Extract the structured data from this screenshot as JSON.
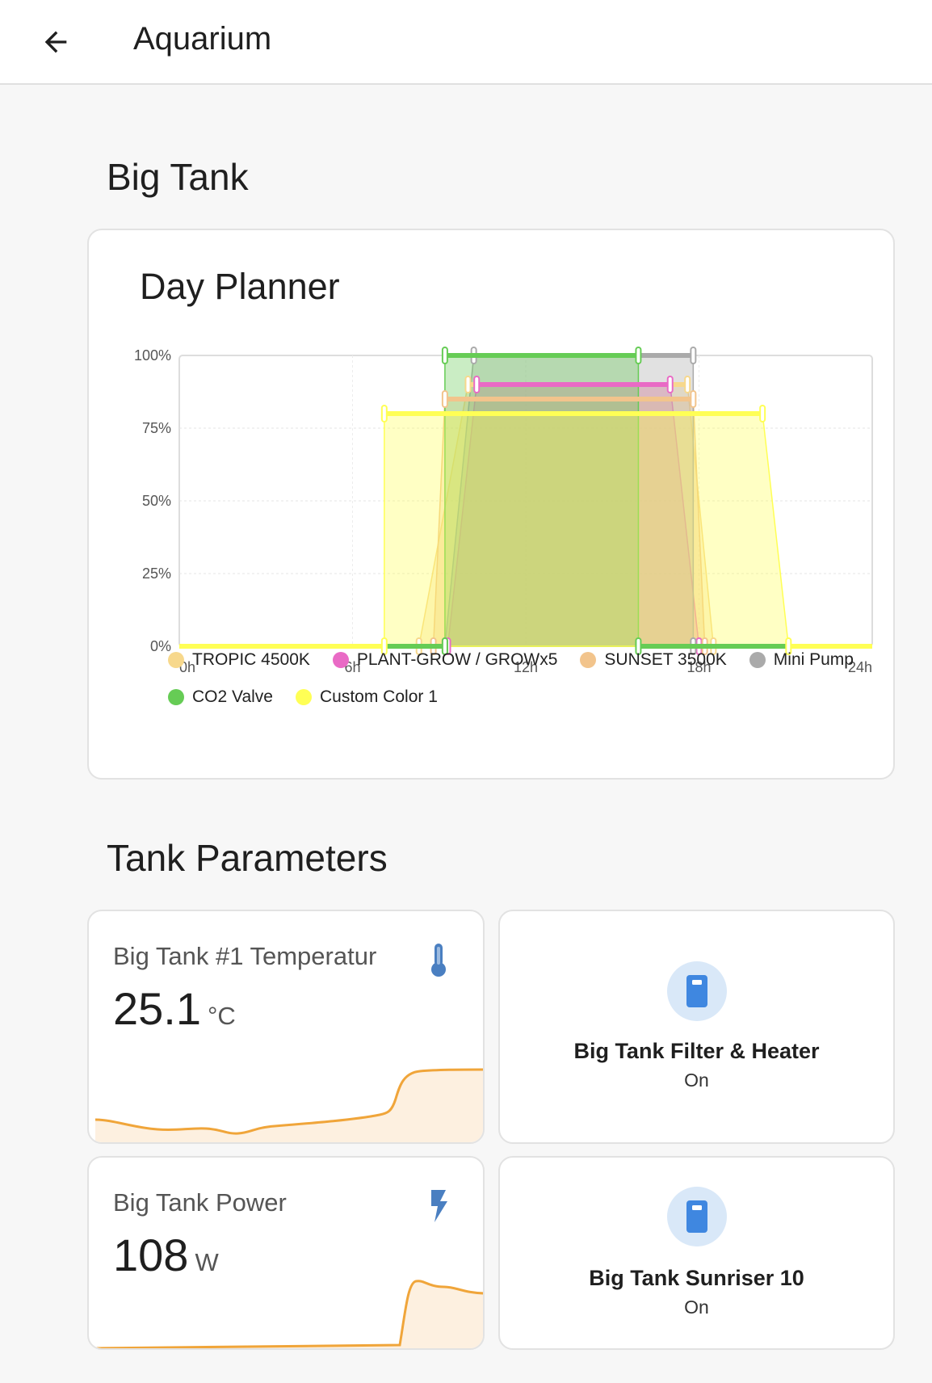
{
  "appbar": {
    "title": "Aquarium"
  },
  "sections": {
    "big_tank": "Big Tank",
    "tank_parameters": "Tank Parameters"
  },
  "planner": {
    "title": "Day Planner",
    "y_ticks": [
      "100%",
      "75%",
      "50%",
      "25%",
      "0%"
    ],
    "x_ticks": [
      "0h",
      "6h",
      "12h",
      "18h",
      "24h"
    ]
  },
  "chart_data": {
    "type": "area",
    "title": "Day Planner",
    "xlim": [
      0,
      24
    ],
    "ylim": [
      0,
      100
    ],
    "x_unit": "h",
    "y_unit": "%",
    "grid": true,
    "legend": "bottom",
    "series": [
      {
        "name": "TROPIC 4500K",
        "color": "#f7d88c",
        "points": [
          [
            0,
            0
          ],
          [
            8.3,
            0
          ],
          [
            10.0,
            90
          ],
          [
            17.6,
            90
          ],
          [
            18.5,
            0
          ],
          [
            24,
            0
          ]
        ]
      },
      {
        "name": "PLANT-GROW / GROWx5",
        "color": "#e96ac5",
        "points": [
          [
            0,
            0
          ],
          [
            9.3,
            0
          ],
          [
            10.3,
            90
          ],
          [
            17.0,
            90
          ],
          [
            18.0,
            0
          ],
          [
            24,
            0
          ]
        ]
      },
      {
        "name": "SUNSET 3500K",
        "color": "#f2c48c",
        "points": [
          [
            0,
            0
          ],
          [
            8.8,
            0
          ],
          [
            9.2,
            85
          ],
          [
            17.8,
            85
          ],
          [
            18.2,
            0
          ],
          [
            24,
            0
          ]
        ]
      },
      {
        "name": "Mini Pump",
        "color": "#aaaaaa",
        "points": [
          [
            0,
            0
          ],
          [
            9.2,
            0
          ],
          [
            10.2,
            100
          ],
          [
            17.8,
            100
          ],
          [
            17.8,
            0
          ],
          [
            24,
            0
          ]
        ]
      },
      {
        "name": "CO2 Valve",
        "color": "#66cc55",
        "points": [
          [
            0,
            0
          ],
          [
            9.2,
            0
          ],
          [
            9.2,
            100
          ],
          [
            15.9,
            100
          ],
          [
            15.9,
            0
          ],
          [
            24,
            0
          ]
        ]
      },
      {
        "name": "Custom Color 1",
        "color": "#ffff55",
        "points": [
          [
            0,
            0
          ],
          [
            7.1,
            0
          ],
          [
            7.1,
            80
          ],
          [
            20.2,
            80
          ],
          [
            21.1,
            0
          ],
          [
            24,
            0
          ]
        ]
      }
    ]
  },
  "legend": [
    {
      "label": "TROPIC 4500K",
      "color": "#f7d88c"
    },
    {
      "label": "PLANT-GROW / GROWx5",
      "color": "#e96ac5"
    },
    {
      "label": "SUNSET 3500K",
      "color": "#f2c48c"
    },
    {
      "label": "Mini Pump",
      "color": "#aaaaaa"
    },
    {
      "label": "CO2 Valve",
      "color": "#66cc55"
    },
    {
      "label": "Custom Color 1",
      "color": "#ffff55"
    }
  ],
  "sensors": {
    "temperature": {
      "name": "Big Tank #1 Temperatur",
      "value": "25.1",
      "unit": "°C",
      "icon": "thermometer-icon"
    },
    "power": {
      "name": "Big Tank Power",
      "value": "108",
      "unit": "W",
      "icon": "lightning-icon"
    }
  },
  "tiles": {
    "filter": {
      "name": "Big Tank Filter & Heater",
      "state": "On",
      "icon": "power-socket-icon"
    },
    "sunriser": {
      "name": "Big Tank Sunriser 10",
      "state": "On",
      "icon": "power-socket-icon"
    }
  },
  "colors": {
    "accent_orange": "#f0a53a",
    "icon_blue": "#4a7fc1",
    "tile_icon": "#3f87e0"
  }
}
